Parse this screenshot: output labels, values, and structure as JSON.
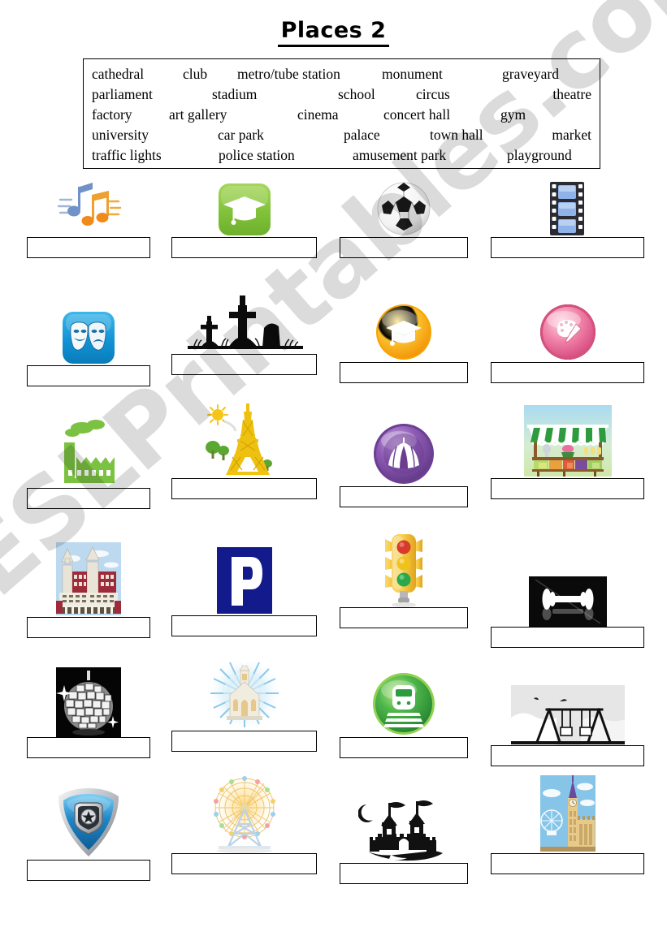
{
  "title": "Places 2",
  "wordbank": {
    "rows": [
      [
        "cathedral",
        "club",
        "metro/tube station",
        "monument",
        "graveyard"
      ],
      [
        "parliament",
        "stadium",
        "school",
        "circus",
        "theatre"
      ],
      [
        "factory",
        "art gallery",
        "cinema",
        "concert hall",
        "gym"
      ],
      [
        "university",
        "car park",
        "palace",
        "town hall",
        "market"
      ],
      [
        "traffic lights",
        "police station",
        "amusement park",
        "playground"
      ]
    ]
  },
  "exercise": {
    "answer_value": "",
    "rows": [
      {
        "cells": [
          {
            "icon": "music-notes-icon",
            "answer": ""
          },
          {
            "icon": "graduation-cap-green-icon",
            "answer": ""
          },
          {
            "icon": "soccer-ball-icon",
            "answer": ""
          },
          {
            "icon": "film-strip-icon",
            "answer": ""
          }
        ]
      },
      {
        "cells": [
          {
            "icon": "theatre-masks-icon",
            "answer": ""
          },
          {
            "icon": "graveyard-icon",
            "answer": ""
          },
          {
            "icon": "graduation-cap-orange-badge-icon",
            "answer": ""
          },
          {
            "icon": "art-palette-pink-badge-icon",
            "answer": ""
          }
        ]
      },
      {
        "cells": [
          {
            "icon": "factory-icon",
            "answer": ""
          },
          {
            "icon": "eiffel-tower-icon",
            "answer": ""
          },
          {
            "icon": "circus-tent-purple-badge-icon",
            "answer": ""
          },
          {
            "icon": "market-stall-icon",
            "answer": ""
          }
        ]
      },
      {
        "cells": [
          {
            "icon": "town-hall-building-icon",
            "answer": ""
          },
          {
            "icon": "parking-sign-icon",
            "answer": ""
          },
          {
            "icon": "traffic-lights-icon",
            "answer": ""
          },
          {
            "icon": "dumbbell-icon",
            "answer": ""
          }
        ]
      },
      {
        "cells": [
          {
            "icon": "disco-ball-icon",
            "answer": ""
          },
          {
            "icon": "church-icon",
            "answer": ""
          },
          {
            "icon": "train-green-badge-icon",
            "answer": ""
          },
          {
            "icon": "swing-set-icon",
            "answer": ""
          }
        ]
      },
      {
        "cells": [
          {
            "icon": "police-shield-icon",
            "answer": ""
          },
          {
            "icon": "ferris-wheel-icon",
            "answer": ""
          },
          {
            "icon": "castle-icon",
            "answer": ""
          },
          {
            "icon": "big-ben-icon",
            "answer": ""
          }
        ]
      }
    ]
  },
  "watermark": {
    "text": "ESLPrintables.com"
  },
  "colors": {
    "ink": "#000000",
    "paper": "#ffffff",
    "watermark": "#cccccc",
    "green": "#7dc242",
    "blue": "#1a9fdc",
    "orange": "#f5a623",
    "pink": "#e0517f",
    "purple": "#7b4397",
    "navy": "#1a1a8c",
    "yellow": "#f2c200"
  }
}
